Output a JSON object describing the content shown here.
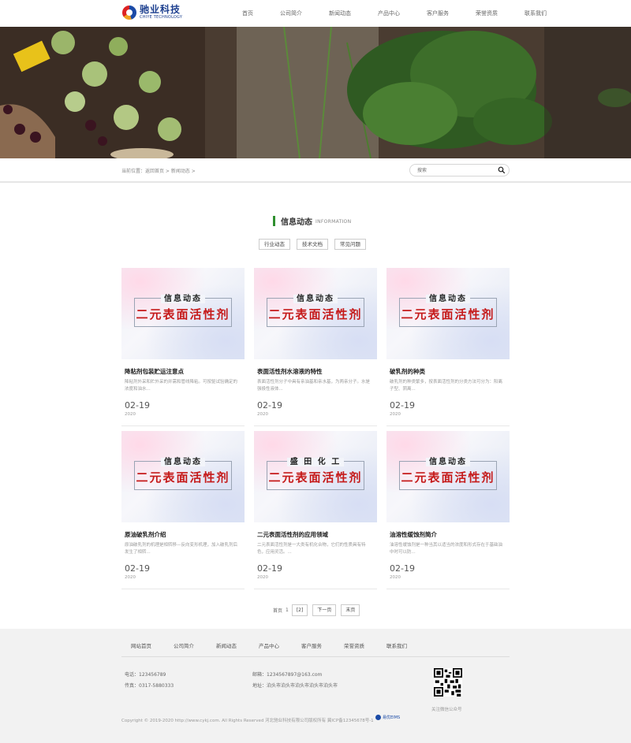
{
  "header": {
    "logo_cn": "驰业科技",
    "logo_en": "CHIYE TECHNOLOGY",
    "nav": [
      "首页",
      "公司简介",
      "新闻动态",
      "产品中心",
      "客户服务",
      "荣誉资质",
      "联系我们"
    ]
  },
  "breadcrumb": "当前位置：返回首页 > 新闻动态 >",
  "search": {
    "placeholder": "搜索"
  },
  "section": {
    "title_cn": "信息动态",
    "title_en": "INFORMATION"
  },
  "tabs": [
    "行业动态",
    "技术文档",
    "常见问题"
  ],
  "cards": [
    {
      "thumb_top": "信息动态",
      "thumb_main": "二元表面活性剂",
      "title": "降粘剂包装贮运注意点",
      "desc": "降粘剂外采和贮外采的并需和管线降粘。可按驱试验确定的浓度和油水...",
      "day": "02-19",
      "year": "2020"
    },
    {
      "thumb_top": "信息动态",
      "thumb_main": "二元表面活性剂",
      "title": "表面活性剂水溶液的特性",
      "desc": "表面活性剂分子中具有亲油基和亲水基，为两亲分子。水是强极性液体...",
      "day": "02-19",
      "year": "2020"
    },
    {
      "thumb_top": "信息动态",
      "thumb_main": "二元表面活性剂",
      "title": "破乳剂的种类",
      "desc": "破乳剂的种类繁多，按表面活性剂的分类方法可分为：阳离子型、阴离...",
      "day": "02-19",
      "year": "2020"
    },
    {
      "thumb_top": "信息动态",
      "thumb_main": "二元表面活性剂",
      "title": "原油破乳剂介绍",
      "desc": "原油破乳剂的机理是相转移—反向变形机理，加入破乳剂后发生了相转...",
      "day": "02-19",
      "year": "2020"
    },
    {
      "thumb_top": "盛 田 化 工",
      "thumb_main": "二元表面活性剂",
      "title": "二元表面活性剂的应用领域",
      "desc": "二元表面活性剂是一大类有机化合物，它们的性质具有特色，应用灵活。...",
      "day": "02-19",
      "year": "2020"
    },
    {
      "thumb_top": "信息动态",
      "thumb_main": "二元表面活性剂",
      "title": "油溶性缓蚀剂简介",
      "desc": "油溶性缓蚀剂是一种当其以适当的浓度和形式存在于基础油中时可以防...",
      "day": "02-19",
      "year": "2020"
    }
  ],
  "pager": {
    "first": "首页",
    "page1": "1",
    "page2": "[2]",
    "next": "下一页",
    "last": "末页"
  },
  "footer": {
    "nav": [
      "网站首页",
      "公司简介",
      "新闻动态",
      "产品中心",
      "客户服务",
      "荣誉资质",
      "联系我们"
    ],
    "phone": "电话：123456789",
    "fax": "传真：0317-5880333",
    "email": "邮箱：12345678​97@163.com",
    "address": "地址：泊头市泊头市泊头市泊头市泊头市",
    "qr_caption": "关注微信公众号",
    "copyright": "Copyright © 2019-2020 http://www.cykj.com. All Rights Reserved 河北驰业科技有限公司版权所有 冀ICP备12345678号-1",
    "cms": "易优EIMS"
  }
}
